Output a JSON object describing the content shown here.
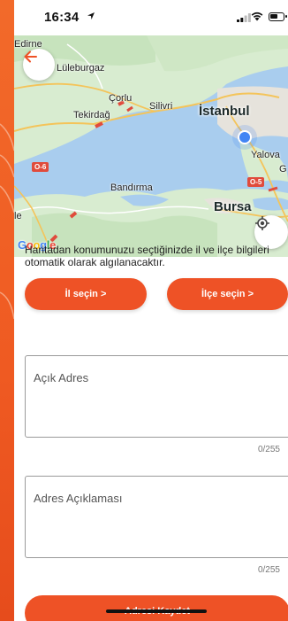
{
  "status_bar": {
    "time": "16:34"
  },
  "map": {
    "labels": {
      "edirne": "Edirne",
      "luleburgaz": "Lüleburgaz",
      "corlu": "Çorlu",
      "silivri": "Silivri",
      "tekirdag": "Tekirdağ",
      "istanbul": "İstanbul",
      "yalova": "Yalova",
      "bandirma": "Bandırma",
      "bursa": "Bursa",
      "g_edge": "G",
      "le_edge": "le"
    },
    "road_badges": {
      "left": "O-6",
      "right": "O-5"
    },
    "attribution": [
      "G",
      "o",
      "o",
      "g",
      "l",
      "e"
    ]
  },
  "info_text": "Haritadan konumunuzu seçtiğinizde il ve ilçe bilgileri otomatik olarak algılanacaktır.",
  "buttons": {
    "province": "İl seçin >",
    "district": "İlçe seçin >",
    "save": "Adresi Kaydet"
  },
  "fields": {
    "address": {
      "placeholder": "Açık Adres",
      "counter": "0/255"
    },
    "description": {
      "placeholder": "Adres Açıklaması",
      "counter": "0/255"
    }
  },
  "colors": {
    "accent": "#ee5226",
    "water": "#a9cdee",
    "land": "#d8ecd0"
  },
  "icons": {
    "back": "arrow-left-icon",
    "locate": "crosshair-icon",
    "location": "location-arrow-icon"
  }
}
